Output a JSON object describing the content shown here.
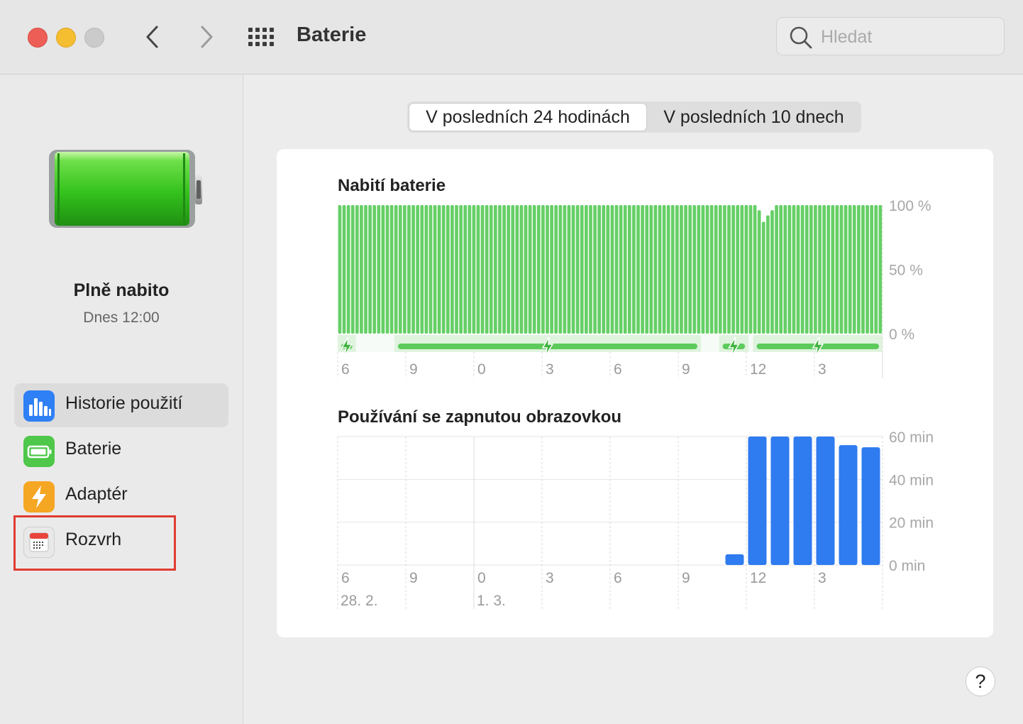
{
  "window": {
    "title": "Baterie"
  },
  "search": {
    "placeholder": "Hledat"
  },
  "sidebar": {
    "status_title": "Plně nabito",
    "status_time": "Dnes 12:00",
    "items": [
      {
        "label": "Historie použití",
        "icon": "bar-chart-icon",
        "selected": true
      },
      {
        "label": "Baterie",
        "icon": "battery-icon",
        "selected": false
      },
      {
        "label": "Adaptér",
        "icon": "lightning-icon",
        "selected": false
      },
      {
        "label": "Rozvrh",
        "icon": "calendar-icon",
        "selected": false
      }
    ]
  },
  "tabs": [
    {
      "label": "V posledních 24 hodinách",
      "active": true
    },
    {
      "label": "V posledních 10 dnech",
      "active": false
    }
  ],
  "colors": {
    "battery_green": "#66cf66",
    "charging_green": "#5ccb5c",
    "usage_blue": "#2f7bf0",
    "highlight_red": "#e03c31"
  },
  "help": {
    "label": "?"
  },
  "chart_data": [
    {
      "type": "bar",
      "title": "Nabití baterie",
      "x_ticks": [
        "6",
        "9",
        "0",
        "3",
        "6",
        "9",
        "12",
        "3"
      ],
      "y_ticks": [
        "100 %",
        "50 %",
        "0 %"
      ],
      "ylim": [
        0,
        100
      ],
      "values": [
        100,
        100,
        100,
        100,
        100,
        100,
        100,
        100,
        100,
        100,
        100,
        100,
        100,
        100,
        100,
        100,
        100,
        100,
        100,
        100,
        100,
        100,
        100,
        100,
        100,
        100,
        100,
        100,
        100,
        100,
        100,
        100,
        100,
        100,
        100,
        100,
        100,
        100,
        100,
        100,
        100,
        100,
        100,
        100,
        100,
        100,
        100,
        100,
        100,
        100,
        100,
        100,
        100,
        100,
        100,
        100,
        100,
        100,
        100,
        100,
        100,
        100,
        100,
        100,
        100,
        100,
        100,
        100,
        100,
        100,
        100,
        100,
        100,
        100,
        100,
        100,
        100,
        100,
        100,
        100,
        100,
        100,
        100,
        100,
        100,
        100,
        100,
        100,
        100,
        100,
        100,
        100,
        100,
        100,
        100,
        100,
        100,
        96,
        87,
        92,
        96,
        100,
        100,
        100,
        100,
        100,
        100,
        100,
        100,
        100,
        100,
        100,
        100,
        100,
        100,
        100,
        100,
        100,
        100,
        100,
        100,
        100,
        100,
        100,
        100,
        100
      ],
      "charging_periods": [
        [
          0.0,
          0.8
        ],
        [
          2.5,
          16.0
        ],
        [
          16.8,
          18.1
        ],
        [
          18.3,
          24.0
        ]
      ]
    },
    {
      "type": "bar",
      "title": "Používání se zapnutou obrazovkou",
      "x_ticks": [
        "6",
        "9",
        "0",
        "3",
        "6",
        "9",
        "12",
        "3"
      ],
      "date_labels": [
        "28. 2.",
        "1. 3."
      ],
      "y_ticks": [
        "60 min",
        "40 min",
        "20 min",
        "0 min"
      ],
      "ylim": [
        0,
        60
      ],
      "values": [
        0,
        0,
        0,
        0,
        0,
        0,
        0,
        0,
        0,
        0,
        0,
        0,
        0,
        0,
        0,
        0,
        0,
        5,
        60,
        60,
        60,
        60,
        56,
        55
      ]
    }
  ]
}
